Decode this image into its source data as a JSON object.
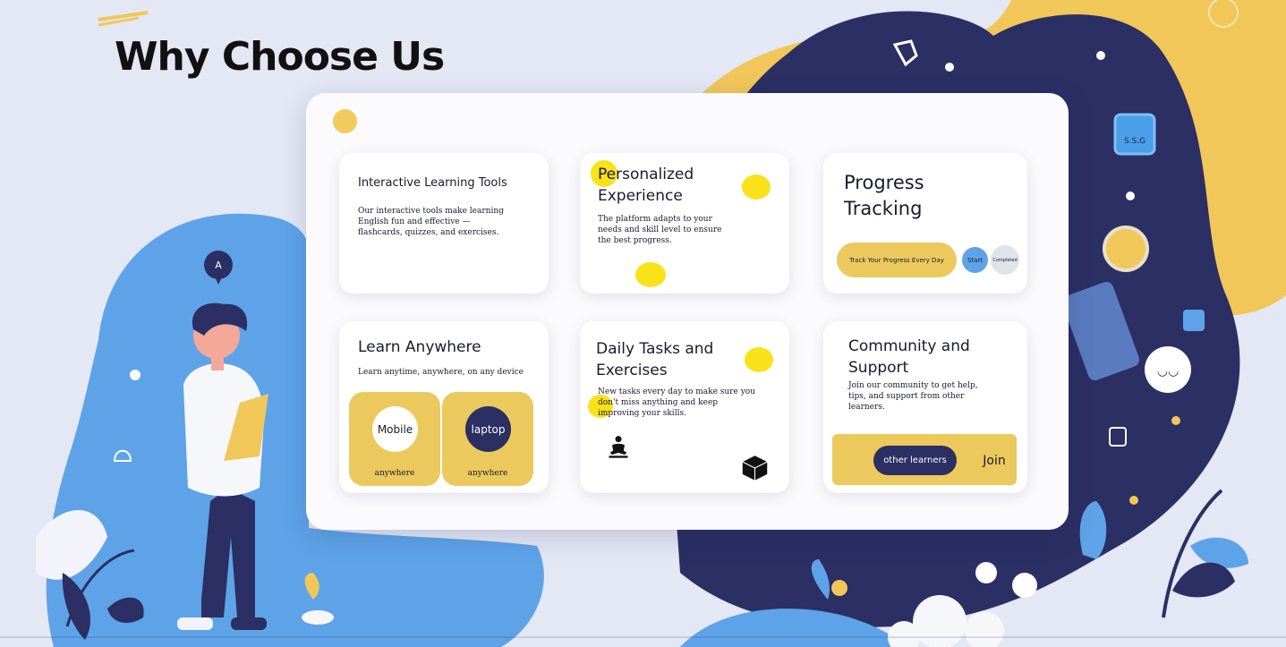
{
  "page": {
    "title": "Why Choose Us"
  },
  "colors": {
    "navy": "#2b2f64",
    "yellow": "#f2cb5d",
    "blue": "#5ea3e8",
    "bg": "#e4e7f4"
  },
  "illustration": {
    "phone_badge": "S.S.G",
    "chat_bubble_icon": "chat-icon",
    "mask_icon": "mask-icon"
  },
  "cards": {
    "interactive": {
      "title": "Interactive Learning Tools",
      "body": "Our interactive tools make learning English fun and effective — flashcards, quizzes, and exercises."
    },
    "personalized": {
      "title": "Personalized Experience",
      "body": "The platform adapts to your needs and skill level to ensure the best progress."
    },
    "progress": {
      "title": "Progress Tracking",
      "track_label": "Track Your Progress Every Day",
      "start_label": "Start",
      "completed_label": "Completed"
    },
    "anywhere": {
      "title": "Learn Anywhere",
      "subtitle": "Learn anytime, anywhere, on any device",
      "tiles": [
        {
          "label": "Mobile",
          "caption": "anywhere"
        },
        {
          "label": "laptop",
          "caption": "anywhere"
        }
      ]
    },
    "daily": {
      "title": "Daily Tasks and Exercises",
      "body": "New tasks every day to make sure you don't miss anything and keep improving your skills.",
      "icons": [
        "meditation-icon",
        "cube-icon"
      ]
    },
    "community": {
      "title": "Community and Support",
      "body": "Join our community to get help, tips, and support from other learners.",
      "learners_label": "other learners",
      "join_label": "Join"
    }
  }
}
